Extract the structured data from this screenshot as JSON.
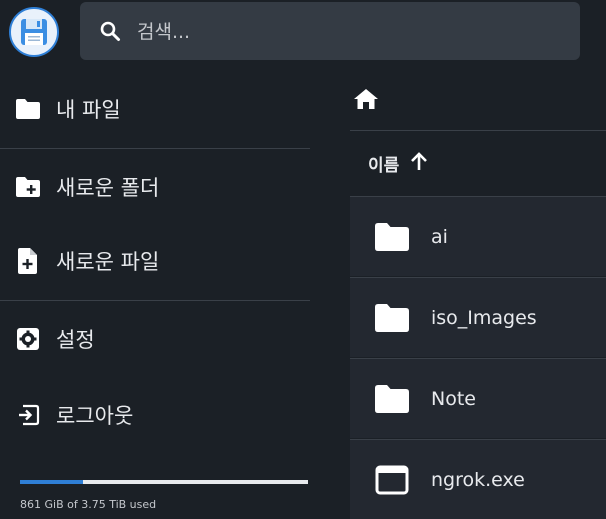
{
  "search": {
    "placeholder": "검색..."
  },
  "sidebar": {
    "items": [
      {
        "label": "내 파일",
        "icon": "folder-icon"
      },
      {
        "label": "새로운 폴더",
        "icon": "new-folder-icon"
      },
      {
        "label": "새로운 파일",
        "icon": "new-file-icon"
      },
      {
        "label": "설정",
        "icon": "settings-icon"
      },
      {
        "label": "로그아웃",
        "icon": "logout-icon"
      }
    ],
    "storage": {
      "text": "861 GiB of 3.75 TiB used",
      "fraction": 0.22
    }
  },
  "main": {
    "header": {
      "name_label": "이름",
      "sort": "ascending"
    },
    "files": [
      {
        "name": "ai",
        "icon": "folder-icon"
      },
      {
        "name": "iso_Images",
        "icon": "folder-icon"
      },
      {
        "name": "Note",
        "icon": "folder-icon"
      },
      {
        "name": "ngrok.exe",
        "icon": "application-icon"
      }
    ]
  },
  "colors": {
    "background": "#1b2026",
    "search_bg": "#343b44",
    "row_bg": "#232830",
    "accent": "#2f7fd6",
    "text": "#e8eaed"
  }
}
